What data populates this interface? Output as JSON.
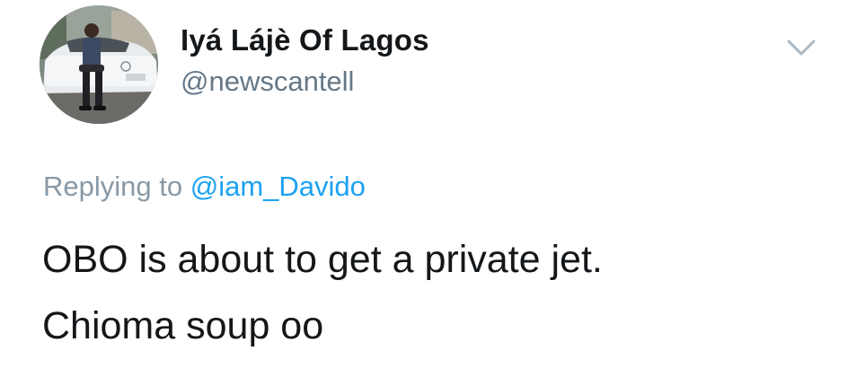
{
  "author": {
    "display_name": "Iyá Lájè Of Lagos",
    "handle": "@newscantell",
    "avatar_label": "profile photo"
  },
  "reply": {
    "prefix": "Replying to",
    "mention": "@iam_Davido"
  },
  "tweet": {
    "lines": [
      "OBO is about to get a private jet.",
      "Chioma soup oo"
    ]
  },
  "icons": {
    "menu": "chevron-down-icon"
  },
  "colors": {
    "name": "#14171a",
    "handle": "#657786",
    "reply_prefix": "#8899a6",
    "mention": "#1da1f2",
    "body": "#14171a",
    "caret": "#aab8c2"
  }
}
